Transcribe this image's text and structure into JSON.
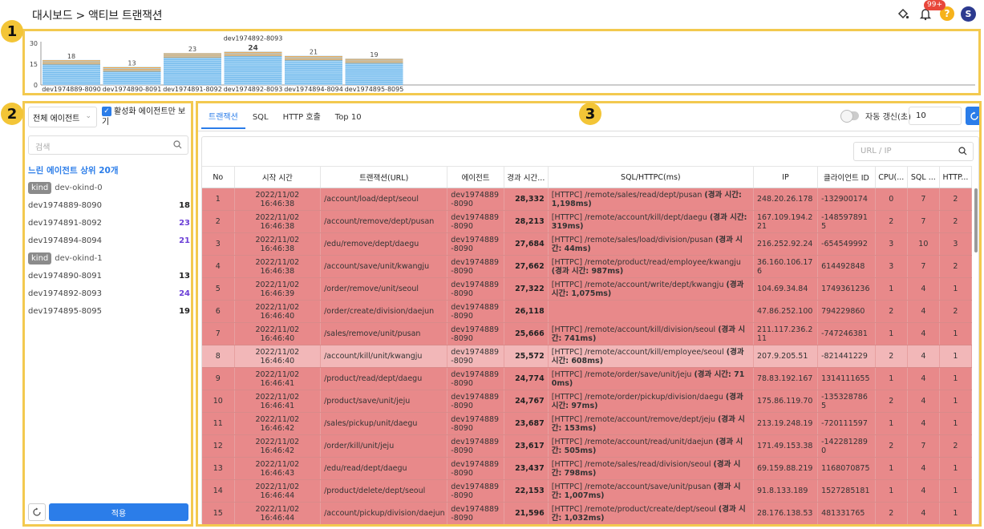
{
  "header": {
    "breadcrumb": "대시보드 > 액티브 트랜잭션",
    "notification_badge": "99+",
    "help_label": "?",
    "avatar_initial": "S"
  },
  "markers": [
    "1",
    "2",
    "3"
  ],
  "chart_data": {
    "type": "bar",
    "categories": [
      "dev1974889-8090",
      "dev1974890-8091",
      "dev1974891-8092",
      "dev1974892-8093",
      "dev1974894-8094",
      "dev1974895-8095"
    ],
    "values": [
      18,
      13,
      23,
      24,
      21,
      19
    ],
    "highlighted": "dev1974892-8093",
    "ylim": [
      0,
      30
    ],
    "yticks": [
      "0",
      "15",
      "30"
    ],
    "colors": {
      "fill": "#a9d6f5",
      "line": "#5fb0ea",
      "top": "#f2a03d"
    }
  },
  "left": {
    "agent_select": "전체 에이전트",
    "active_only_label": "활성화 에이전트만 보기",
    "search_placeholder": "검색",
    "slow_title": "느린 에이전트 상위 20개",
    "groups": [
      {
        "kind": "kind",
        "name": "dev-okind-0",
        "agents": [
          {
            "name": "dev1974889-8090",
            "count": "18",
            "purple": false
          },
          {
            "name": "dev1974891-8092",
            "count": "23",
            "purple": true
          },
          {
            "name": "dev1974894-8094",
            "count": "21",
            "purple": true
          }
        ]
      },
      {
        "kind": "kind",
        "name": "dev-okind-1",
        "agents": [
          {
            "name": "dev1974890-8091",
            "count": "13",
            "purple": false
          },
          {
            "name": "dev1974892-8093",
            "count": "24",
            "purple": true
          },
          {
            "name": "dev1974895-8095",
            "count": "19",
            "purple": false
          }
        ]
      }
    ],
    "apply_label": "적용"
  },
  "main": {
    "tabs": [
      "트랜잭션",
      "SQL",
      "HTTP 호출",
      "Top 10"
    ],
    "auto_refresh_label": "자동 갱신(초)",
    "interval_value": "10",
    "url_search_placeholder": "URL / IP",
    "columns": [
      "No",
      "시작 시간",
      "트랜잭션(URL)",
      "에이전트",
      "경과 시간...",
      "SQL/HTTPC(ms)",
      "IP",
      "클라이언트 ID",
      "CPU(...",
      "SQL ...",
      "HTTP..."
    ],
    "rows": [
      {
        "no": "1",
        "time": "2022/11/02 16:46:38",
        "url": "/account/load/dept/seoul",
        "agent": "dev1974889-8090",
        "elapsed": "28,332",
        "sql": "[HTTPC] /remote/sales/read/dept/pusan ",
        "sql_b": "(경과 시간: 1,198ms)",
        "ip": "248.20.26.178",
        "client": "-132900174",
        "cpu": "0",
        "sqlc": "7",
        "http": "2",
        "light": false
      },
      {
        "no": "2",
        "time": "2022/11/02 16:46:38",
        "url": "/account/remove/dept/pusan",
        "agent": "dev1974889-8090",
        "elapsed": "28,213",
        "sql": "[HTTPC] /remote/account/kill/dept/daegu ",
        "sql_b": "(경과 시간: 319ms)",
        "ip": "167.109.194.221",
        "client": "-1485978915",
        "cpu": "2",
        "sqlc": "7",
        "http": "2",
        "light": false
      },
      {
        "no": "3",
        "time": "2022/11/02 16:46:38",
        "url": "/edu/remove/dept/daegu",
        "agent": "dev1974889-8090",
        "elapsed": "27,684",
        "sql": "[HTTPC] /remote/sales/load/division/pusan ",
        "sql_b": "(경과 시간: 44ms)",
        "ip": "216.252.92.24",
        "client": "-654549992",
        "cpu": "3",
        "sqlc": "10",
        "http": "3",
        "light": false
      },
      {
        "no": "4",
        "time": "2022/11/02 16:46:38",
        "url": "/account/save/unit/kwangju",
        "agent": "dev1974889-8090",
        "elapsed": "27,662",
        "sql": "[HTTPC] /remote/product/read/employee/kwangju ",
        "sql_b": "(경과 시간: 987ms)",
        "ip": "36.160.106.176",
        "client": "614492848",
        "cpu": "3",
        "sqlc": "7",
        "http": "2",
        "light": false
      },
      {
        "no": "5",
        "time": "2022/11/02 16:46:39",
        "url": "/order/remove/unit/seoul",
        "agent": "dev1974889-8090",
        "elapsed": "27,322",
        "sql": "[HTTPC] /remote/account/write/dept/kwangju ",
        "sql_b": "(경과 시간: 1,075ms)",
        "ip": "104.69.34.84",
        "client": "1749361236",
        "cpu": "1",
        "sqlc": "4",
        "http": "1",
        "light": false
      },
      {
        "no": "6",
        "time": "2022/11/02 16:46:40",
        "url": "/order/create/division/daejun",
        "agent": "dev1974889-8090",
        "elapsed": "26,118",
        "sql": "",
        "sql_b": "",
        "ip": "47.86.252.100",
        "client": "794229860",
        "cpu": "2",
        "sqlc": "4",
        "http": "2",
        "light": false
      },
      {
        "no": "7",
        "time": "2022/11/02 16:46:40",
        "url": "/sales/remove/unit/pusan",
        "agent": "dev1974889-8090",
        "elapsed": "25,666",
        "sql": "[HTTPC] /remote/account/kill/division/seoul ",
        "sql_b": "(경과 시간: 741ms)",
        "ip": "211.117.236.211",
        "client": "-747246381",
        "cpu": "1",
        "sqlc": "4",
        "http": "1",
        "light": false
      },
      {
        "no": "8",
        "time": "2022/11/02 16:46:40",
        "url": "/account/kill/unit/kwangju",
        "agent": "dev1974889-8090",
        "elapsed": "25,572",
        "sql": "[HTTPC] /remote/account/kill/employee/seoul ",
        "sql_b": "(경과 시간: 608ms)",
        "ip": "207.9.205.51",
        "client": "-821441229",
        "cpu": "2",
        "sqlc": "4",
        "http": "1",
        "light": true
      },
      {
        "no": "9",
        "time": "2022/11/02 16:46:41",
        "url": "/product/read/dept/daegu",
        "agent": "dev1974889-8090",
        "elapsed": "24,774",
        "sql": "[HTTPC] /remote/order/save/unit/jeju ",
        "sql_b": "(경과 시간: 710ms)",
        "ip": "78.83.192.167",
        "client": "1314111655",
        "cpu": "1",
        "sqlc": "4",
        "http": "1",
        "light": false
      },
      {
        "no": "10",
        "time": "2022/11/02 16:46:41",
        "url": "/product/save/unit/jeju",
        "agent": "dev1974889-8090",
        "elapsed": "24,767",
        "sql": "[HTTPC] /remote/order/pickup/division/daegu ",
        "sql_b": "(경과 시간: 97ms)",
        "ip": "175.86.119.70",
        "client": "-1353287865",
        "cpu": "2",
        "sqlc": "4",
        "http": "1",
        "light": false
      },
      {
        "no": "11",
        "time": "2022/11/02 16:46:42",
        "url": "/sales/pickup/unit/daegu",
        "agent": "dev1974889-8090",
        "elapsed": "23,687",
        "sql": "[HTTPC] /remote/account/remove/dept/jeju ",
        "sql_b": "(경과 시간: 153ms)",
        "ip": "213.19.248.19",
        "client": "-720111597",
        "cpu": "1",
        "sqlc": "4",
        "http": "1",
        "light": false
      },
      {
        "no": "12",
        "time": "2022/11/02 16:46:42",
        "url": "/order/kill/unit/jeju",
        "agent": "dev1974889-8090",
        "elapsed": "23,617",
        "sql": "[HTTPC] /remote/account/read/unit/daejun ",
        "sql_b": "(경과 시간: 505ms)",
        "ip": "171.49.153.38",
        "client": "-1422812890",
        "cpu": "2",
        "sqlc": "7",
        "http": "2",
        "light": false
      },
      {
        "no": "13",
        "time": "2022/11/02 16:46:43",
        "url": "/edu/read/dept/daegu",
        "agent": "dev1974889-8090",
        "elapsed": "23,437",
        "sql": "[HTTPC] /remote/sales/read/division/seoul ",
        "sql_b": "(경과 시간: 798ms)",
        "ip": "69.159.88.219",
        "client": "1168070875",
        "cpu": "1",
        "sqlc": "4",
        "http": "1",
        "light": false
      },
      {
        "no": "14",
        "time": "2022/11/02 16:46:44",
        "url": "/product/delete/dept/seoul",
        "agent": "dev1974889-8090",
        "elapsed": "22,153",
        "sql": "[HTTPC] /remote/account/save/unit/pusan ",
        "sql_b": "(경과 시간: 1,007ms)",
        "ip": "91.8.133.189",
        "client": "1527285181",
        "cpu": "1",
        "sqlc": "4",
        "http": "1",
        "light": false
      },
      {
        "no": "15",
        "time": "2022/11/02 16:46:44",
        "url": "/account/pickup/division/daejun",
        "agent": "dev1974889-8090",
        "elapsed": "21,596",
        "sql": "[HTTPC] /remote/product/create/dept/seoul ",
        "sql_b": "(경과 시간: 1,032ms)",
        "ip": "28.176.138.53",
        "client": "481331765",
        "cpu": "2",
        "sqlc": "4",
        "http": "1",
        "light": false
      }
    ]
  }
}
